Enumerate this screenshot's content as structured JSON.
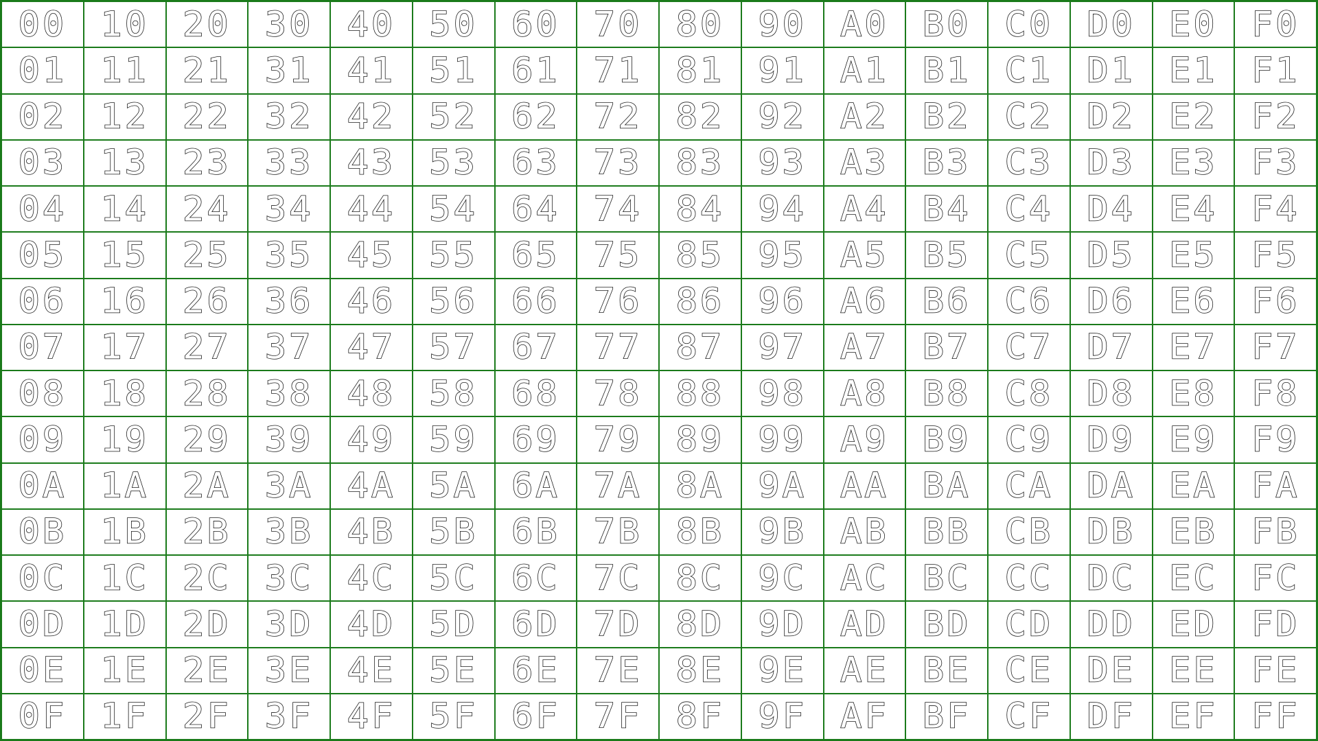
{
  "grid": {
    "rows": 16,
    "columns": 16,
    "border_color": "#1a7a1a",
    "glyph_stroke_color": "#1a1a1a",
    "glyph_fill_color": "#ffffff",
    "cells": [
      [
        "00",
        "10",
        "20",
        "30",
        "40",
        "50",
        "60",
        "70",
        "80",
        "90",
        "A0",
        "B0",
        "C0",
        "D0",
        "E0",
        "F0"
      ],
      [
        "01",
        "11",
        "21",
        "31",
        "41",
        "51",
        "61",
        "71",
        "81",
        "91",
        "A1",
        "B1",
        "C1",
        "D1",
        "E1",
        "F1"
      ],
      [
        "02",
        "12",
        "22",
        "32",
        "42",
        "52",
        "62",
        "72",
        "82",
        "92",
        "A2",
        "B2",
        "C2",
        "D2",
        "E2",
        "F2"
      ],
      [
        "03",
        "13",
        "23",
        "33",
        "43",
        "53",
        "63",
        "73",
        "83",
        "93",
        "A3",
        "B3",
        "C3",
        "D3",
        "E3",
        "F3"
      ],
      [
        "04",
        "14",
        "24",
        "34",
        "44",
        "54",
        "64",
        "74",
        "84",
        "94",
        "A4",
        "B4",
        "C4",
        "D4",
        "E4",
        "F4"
      ],
      [
        "05",
        "15",
        "25",
        "35",
        "45",
        "55",
        "65",
        "75",
        "85",
        "95",
        "A5",
        "B5",
        "C5",
        "D5",
        "E5",
        "F5"
      ],
      [
        "06",
        "16",
        "26",
        "36",
        "46",
        "56",
        "66",
        "76",
        "86",
        "96",
        "A6",
        "B6",
        "C6",
        "D6",
        "E6",
        "F6"
      ],
      [
        "07",
        "17",
        "27",
        "37",
        "47",
        "57",
        "67",
        "77",
        "87",
        "97",
        "A7",
        "B7",
        "C7",
        "D7",
        "E7",
        "F7"
      ],
      [
        "08",
        "18",
        "28",
        "38",
        "48",
        "58",
        "68",
        "78",
        "88",
        "98",
        "A8",
        "B8",
        "C8",
        "D8",
        "E8",
        "F8"
      ],
      [
        "09",
        "19",
        "29",
        "39",
        "49",
        "59",
        "69",
        "79",
        "89",
        "99",
        "A9",
        "B9",
        "C9",
        "D9",
        "E9",
        "F9"
      ],
      [
        "0A",
        "1A",
        "2A",
        "3A",
        "4A",
        "5A",
        "6A",
        "7A",
        "8A",
        "9A",
        "AA",
        "BA",
        "CA",
        "DA",
        "EA",
        "FA"
      ],
      [
        "0B",
        "1B",
        "2B",
        "3B",
        "4B",
        "5B",
        "6B",
        "7B",
        "8B",
        "9B",
        "AB",
        "BB",
        "CB",
        "DB",
        "EB",
        "FB"
      ],
      [
        "0C",
        "1C",
        "2C",
        "3C",
        "4C",
        "5C",
        "6C",
        "7C",
        "8C",
        "9C",
        "AC",
        "BC",
        "CC",
        "DC",
        "EC",
        "FC"
      ],
      [
        "0D",
        "1D",
        "2D",
        "3D",
        "4D",
        "5D",
        "6D",
        "7D",
        "8D",
        "9D",
        "AD",
        "BD",
        "CD",
        "DD",
        "ED",
        "FD"
      ],
      [
        "0E",
        "1E",
        "2E",
        "3E",
        "4E",
        "5E",
        "6E",
        "7E",
        "8E",
        "9E",
        "AE",
        "BE",
        "CE",
        "DE",
        "EE",
        "FE"
      ],
      [
        "0F",
        "1F",
        "2F",
        "3F",
        "4F",
        "5F",
        "6F",
        "7F",
        "8F",
        "9F",
        "AF",
        "BF",
        "CF",
        "DF",
        "EF",
        "FF"
      ]
    ]
  }
}
